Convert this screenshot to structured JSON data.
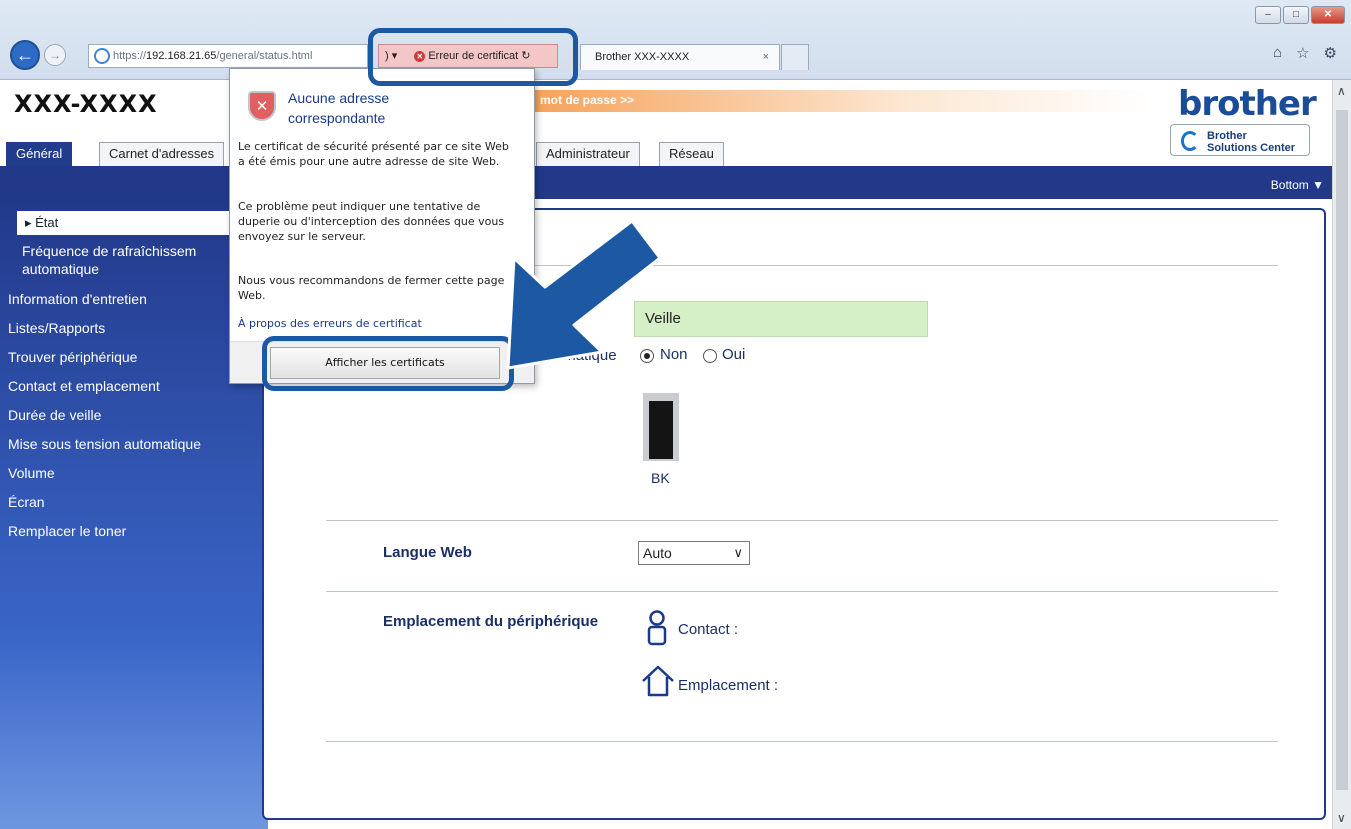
{
  "browser": {
    "address_scheme": "https://",
    "address_host": "192.168.21.65",
    "address_path": "/general/status.html",
    "address_suffix": ")",
    "cert_tab_label": "Erreur de certificat",
    "cert_tab_refresh": "↻",
    "page_tab_label": "Brother XXX-XXXX",
    "page_tab_close": "×",
    "window_minimize": "–",
    "window_maximize": "□",
    "window_close": "✕",
    "home_icon": "⌂",
    "star_icon": "☆",
    "gear_icon": "⚙"
  },
  "header": {
    "model": "XXX-XXXX",
    "password_link": "mot de passe >>",
    "logo": "brother",
    "bsc_line1": "Brother",
    "bsc_line2": "Solutions Center"
  },
  "tabs": {
    "general": "Général",
    "address_book": "Carnet d'adresses",
    "admin": "Administrateur",
    "network": "Réseau"
  },
  "band": {
    "bottom_link": "Bottom ▼"
  },
  "sidebar": {
    "etat": "▸ État",
    "refresh_line1": "Fréquence de rafraîchissem",
    "refresh_line2": "automatique",
    "items": [
      "Information d'entretien",
      "Listes/Rapports",
      "Trouver périphérique",
      "Contact et emplacement",
      "Durée de veille",
      "Mise sous tension automatique",
      "Volume",
      "Écran",
      "Remplacer le toner"
    ]
  },
  "content": {
    "status_value": "Veille",
    "auto_refresh_label": "automatique",
    "radio_no": "Non",
    "radio_yes": "Oui",
    "toner_label": "BK",
    "toner_level": 0.9,
    "web_lang_label": "Langue Web",
    "web_lang_value": "Auto",
    "device_location_label": "Emplacement du périphérique",
    "contact_label": "Contact :",
    "location_label": "Emplacement :"
  },
  "popup": {
    "heading_line1": "Aucune adresse",
    "heading_line2": "correspondante",
    "para1": "Le certificat de sécurité présenté par ce site Web a été émis pour une autre adresse de site Web.",
    "para2": "Ce problème peut indiquer une tentative de duperie ou d'interception des données que vous envoyez sur le serveur.",
    "para3": "Nous vous recommandons de fermer cette page Web.",
    "link": "À propos des erreurs de certificat",
    "button": "Afficher les certificats"
  },
  "colors": {
    "accent_blue": "#22398a",
    "highlight_blue": "#1d58a3",
    "status_green": "#d5efc6",
    "cert_error_red": "#f4c6c6"
  }
}
